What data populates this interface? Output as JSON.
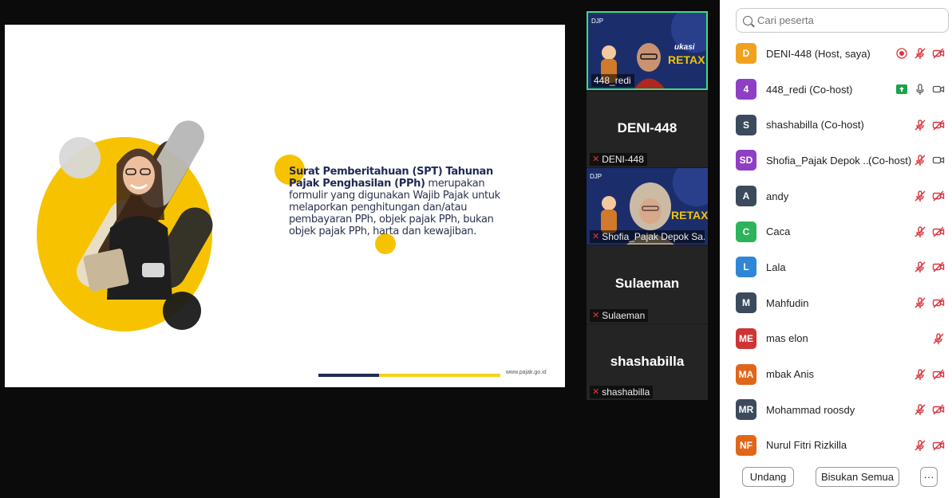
{
  "slide": {
    "title_bold": "Surat Pemberitahuan (SPT) Tahunan Pajak Penghasilan (PPh)",
    "body": " merupakan formulir yang digunakan Wajib Pajak untuk melaporkan penghitungan dan/atau pembayaran PPh, objek pajak PPh, bukan objek pajak PPh, harta dan kewajiban.",
    "url": "www.pajak.go.id",
    "accent_color": "#f7c300",
    "navy_color": "#1f2a55"
  },
  "video_strip": {
    "tiles": [
      {
        "label": "448_redi",
        "active": true,
        "has_video": true,
        "banner_text": "RETAX",
        "banner_sub": "Edukasi"
      },
      {
        "name": "DENI-448",
        "label": "DENI-448",
        "muted": true
      },
      {
        "label": "Shofia_Pajak Depok Sa...",
        "has_video": true,
        "banner_text": "RETAX",
        "muted": true
      },
      {
        "name": "Sulaeman",
        "label": "Sulaeman",
        "muted": true
      },
      {
        "name": "shashabilla",
        "label": "shashabilla",
        "muted": true
      }
    ]
  },
  "participants_panel": {
    "search_placeholder": "Cari peserta",
    "participants": [
      {
        "initial": "D",
        "name": "DENI-448 (Host, saya)",
        "color": "#f0a21f",
        "icons": [
          "record",
          "mic-off",
          "video-off"
        ]
      },
      {
        "initial": "4",
        "name": "448_redi (Co-host)",
        "color": "#8e3fc4",
        "icons": [
          "share",
          "mic-on",
          "video-on"
        ]
      },
      {
        "initial": "S",
        "name": "shashabilla (Co-host)",
        "color": "#3b4a5c",
        "icons": [
          "mic-off",
          "video-off"
        ]
      },
      {
        "initial": "SD",
        "name": "Shofia_Pajak Depok ...",
        "color": "#8e3fc4",
        "suffix": "(Co-host)",
        "icons": [
          "mic-off",
          "video-on"
        ]
      },
      {
        "initial": "A",
        "name": "andy",
        "color": "#3b4a5c",
        "icons": [
          "mic-off",
          "video-off"
        ]
      },
      {
        "initial": "C",
        "name": "Caca",
        "color": "#2db35a",
        "icons": [
          "mic-off",
          "video-off"
        ]
      },
      {
        "initial": "L",
        "name": "Lala",
        "color": "#2f86d6",
        "icons": [
          "mic-off",
          "video-off"
        ]
      },
      {
        "initial": "M",
        "name": "Mahfudin",
        "color": "#3b4a5c",
        "icons": [
          "mic-off",
          "video-off"
        ]
      },
      {
        "initial": "ME",
        "name": "mas elon",
        "color": "#cf3434",
        "icons": [
          "mic-off"
        ]
      },
      {
        "initial": "MA",
        "name": "mbak Anis",
        "color": "#e0671a",
        "icons": [
          "mic-off",
          "video-off"
        ]
      },
      {
        "initial": "MR",
        "name": "Mohammad roosdy",
        "color": "#3b4a5c",
        "icons": [
          "mic-off",
          "video-off"
        ]
      },
      {
        "initial": "NF",
        "name": "Nurul Fitri Rizkilla",
        "color": "#e0671a",
        "icons": [
          "mic-off",
          "video-off"
        ]
      }
    ],
    "footer": {
      "invite_label": "Undang",
      "mute_all_label": "Bisukan Semua",
      "more_label": "···"
    }
  }
}
